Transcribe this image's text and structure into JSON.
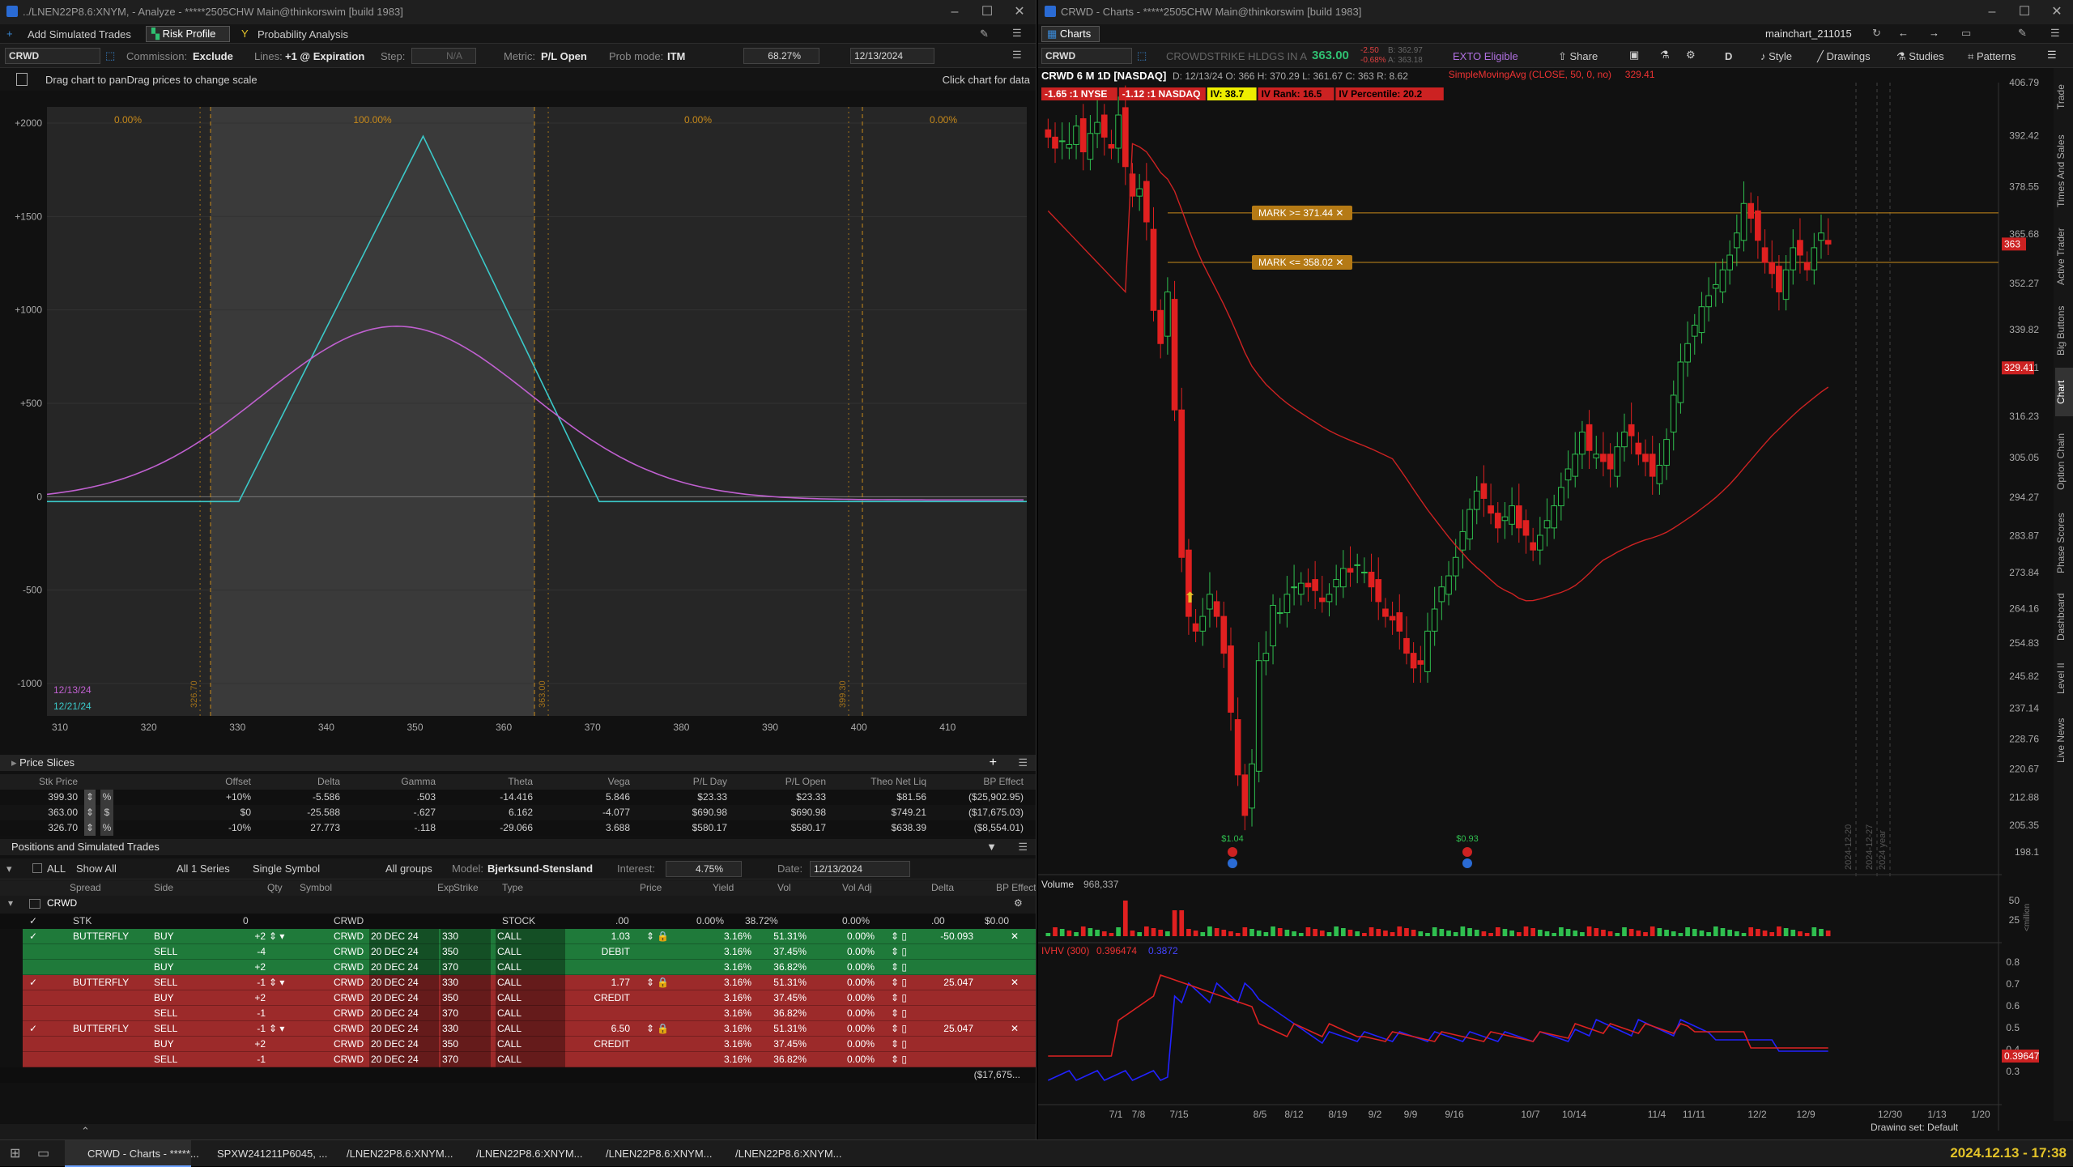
{
  "left": {
    "title": "../LNEN22P8.6:XNYM, - Analyze - *****2505CHW Main@thinkorswim [build 1983]",
    "toolbar": {
      "add_sim": "Add Simulated Trades",
      "risk_profile": "Risk Profile",
      "prob_analysis": "Probability Analysis"
    },
    "controls": {
      "symbol": "CRWD",
      "commission_lbl": "Commission:",
      "commission": "Exclude",
      "lines_lbl": "Lines:",
      "lines": "+1 @ Expiration",
      "step_lbl": "Step:",
      "step": "N/A",
      "metric_lbl": "Metric:",
      "metric": "P/L Open",
      "prob_lbl": "Prob mode:",
      "prob": "ITM",
      "pct": "68.27%",
      "date": "12/13/2024"
    },
    "hint": "Drag chart to panDrag prices to change scale",
    "click_hint": "Click chart for data",
    "chart": {
      "y_ticks": [
        "+2000",
        "+1500",
        "+1000",
        "+500",
        "0",
        "-500",
        "-1000"
      ],
      "y_vals": [
        2000,
        1500,
        1000,
        500,
        0,
        -500,
        -1000
      ],
      "x_ticks": [
        "310",
        "320",
        "330",
        "340",
        "350",
        "360",
        "370",
        "380",
        "390",
        "400",
        "410"
      ],
      "x_vals": [
        310,
        320,
        330,
        340,
        350,
        360,
        370,
        380,
        390,
        400,
        410
      ],
      "zone_labels": [
        "0.00%",
        "100.00%",
        "0.00%",
        "0.00%"
      ],
      "vlines": [
        "326.70",
        "363.00",
        "399.30"
      ],
      "legend": [
        "12/13/24",
        "12/21/24"
      ]
    },
    "price_slices": {
      "title": "Price Slices",
      "headers": [
        "Stk Price",
        "Offset",
        "Delta",
        "Gamma",
        "Theta",
        "Vega",
        "P/L Day",
        "P/L Open",
        "Theo Net Liq",
        "BP Effect"
      ],
      "rows": [
        {
          "stk": "399.30",
          "unit": "%",
          "offset": "+10%",
          "delta": "-5.586",
          "gamma": ".503",
          "theta": "-14.416",
          "vega": "5.846",
          "pld": "$23.33",
          "plo": "$23.33",
          "theo": "$81.56",
          "bp": "($25,902.95)"
        },
        {
          "stk": "363.00",
          "unit": "$",
          "offset": "$0",
          "delta": "-25.588",
          "gamma": "-.627",
          "theta": "6.162",
          "vega": "-4.077",
          "pld": "$690.98",
          "plo": "$690.98",
          "theo": "$749.21",
          "bp": "($17,675.03)"
        },
        {
          "stk": "326.70",
          "unit": "%",
          "offset": "-10%",
          "delta": "27.773",
          "gamma": "-.118",
          "theta": "-29.066",
          "vega": "3.688",
          "pld": "$580.17",
          "plo": "$580.17",
          "theo": "$638.39",
          "bp": "($8,554.01)"
        }
      ]
    },
    "positions": {
      "title": "Positions and Simulated Trades",
      "all": "ALL",
      "show": "Show All",
      "series": "All 1 Series",
      "single": "Single Symbol",
      "groups": "All groups",
      "model_lbl": "Model:",
      "model": "Bjerksund-Stensland",
      "interest_lbl": "Interest:",
      "interest": "4.75%",
      "date_lbl": "Date:",
      "date": "12/13/2024",
      "headers": [
        "Spread",
        "Side",
        "Qty",
        "Symbol",
        "Exp",
        "Strike",
        "Type",
        "Price",
        "Yield",
        "Vol",
        "Vol Adj",
        "Delta",
        "BP Effect"
      ],
      "group": "CRWD",
      "stk": {
        "spread": "STK",
        "qty": "0",
        "symbol": "CRWD",
        "type": "STOCK",
        "price": ".00",
        "yield": "0.00%",
        "vol": "38.72%",
        "voladj": "0.00%",
        "delta": ".00",
        "bp": "$0.00"
      },
      "rows": [
        {
          "cls": "grn",
          "spread": "BUTTERFLY",
          "side": "BUY",
          "qty": "+2",
          "symbol": "CRWD",
          "exp": "20 DEC 24",
          "strike": "330",
          "type": "CALL",
          "price": "1.03",
          "yield": "3.16%",
          "vol": "51.31%",
          "voladj": "0.00%",
          "delta": "-50.093"
        },
        {
          "cls": "grn",
          "spread": "",
          "side": "SELL",
          "qty": "-4",
          "symbol": "CRWD",
          "exp": "20 DEC 24",
          "strike": "350",
          "type": "CALL",
          "price": "DEBIT",
          "yield": "3.16%",
          "vol": "37.45%",
          "voladj": "0.00%",
          "delta": ""
        },
        {
          "cls": "grn",
          "spread": "",
          "side": "BUY",
          "qty": "+2",
          "symbol": "CRWD",
          "exp": "20 DEC 24",
          "strike": "370",
          "type": "CALL",
          "price": "",
          "yield": "3.16%",
          "vol": "36.82%",
          "voladj": "0.00%",
          "delta": ""
        },
        {
          "cls": "red",
          "spread": "BUTTERFLY",
          "side": "SELL",
          "qty": "-1",
          "symbol": "CRWD",
          "exp": "20 DEC 24",
          "strike": "330",
          "type": "CALL",
          "price": "1.77",
          "yield": "3.16%",
          "vol": "51.31%",
          "voladj": "0.00%",
          "delta": "25.047"
        },
        {
          "cls": "red",
          "spread": "",
          "side": "BUY",
          "qty": "+2",
          "symbol": "CRWD",
          "exp": "20 DEC 24",
          "strike": "350",
          "type": "CALL",
          "price": "CREDIT",
          "yield": "3.16%",
          "vol": "37.45%",
          "voladj": "0.00%",
          "delta": ""
        },
        {
          "cls": "red",
          "spread": "",
          "side": "SELL",
          "qty": "-1",
          "symbol": "CRWD",
          "exp": "20 DEC 24",
          "strike": "370",
          "type": "CALL",
          "price": "",
          "yield": "3.16%",
          "vol": "36.82%",
          "voladj": "0.00%",
          "delta": ""
        },
        {
          "cls": "red",
          "spread": "BUTTERFLY",
          "side": "SELL",
          "qty": "-1",
          "symbol": "CRWD",
          "exp": "20 DEC 24",
          "strike": "330",
          "type": "CALL",
          "price": "6.50",
          "yield": "3.16%",
          "vol": "51.31%",
          "voladj": "0.00%",
          "delta": "25.047"
        },
        {
          "cls": "red",
          "spread": "",
          "side": "BUY",
          "qty": "+2",
          "symbol": "CRWD",
          "exp": "20 DEC 24",
          "strike": "350",
          "type": "CALL",
          "price": "CREDIT",
          "yield": "3.16%",
          "vol": "37.45%",
          "voladj": "0.00%",
          "delta": ""
        },
        {
          "cls": "red",
          "spread": "",
          "side": "SELL",
          "qty": "-1",
          "symbol": "CRWD",
          "exp": "20 DEC 24",
          "strike": "370",
          "type": "CALL",
          "price": "",
          "yield": "3.16%",
          "vol": "36.82%",
          "voladj": "0.00%",
          "delta": ""
        }
      ],
      "total_bp": "($17,675..."
    }
  },
  "right": {
    "title": "CRWD - Charts - *****2505CHW Main@thinkorswim [build 1983]",
    "tab": "Charts",
    "layout": "mainchart_211015",
    "symbol": "CRWD",
    "company": "CROWDSTRIKE HLDGS IN A",
    "price": "363.00",
    "change": "-2.50",
    "change_pct": "-0.68%",
    "bid": "B: 362.97",
    "ask": "A: 363.18",
    "exto": "EXTO Eligible",
    "tools": [
      "Share",
      "D",
      "Style",
      "Drawings",
      "Studies",
      "Patterns"
    ],
    "header": "CRWD 6 M 1D [NASDAQ]",
    "ohlc": "D: 12/13/24 O: 366 H: 370.29 L: 361.67 C: 363 R: 8.62",
    "chips": [
      "-1.65 :1 NYSE",
      "-1.12 :1 NASDAQ",
      "IV: 38.7",
      "IV Rank: 16.5",
      "IV Percentile: 20.2"
    ],
    "sma": "SimpleMovingAvg (CLOSE, 50, 0, no)",
    "sma_val": "329.41",
    "alerts": [
      "MARK >= 371.44",
      "MARK <= 358.02"
    ],
    "price_axis": [
      "406.79",
      "392.42",
      "378.55",
      "365.68",
      "352.27",
      "339.82",
      "329.41",
      "316.23",
      "305.05",
      "294.27",
      "283.87",
      "273.84",
      "264.16",
      "254.83",
      "245.82",
      "237.14",
      "228.76",
      "220.67",
      "212.88",
      "205.35",
      "198.1"
    ],
    "price_tag": "363",
    "sma_tag": "329.41",
    "date_axis": [
      "7/1",
      "7/8",
      "7/15",
      "8/5",
      "8/12",
      "8/19",
      "9/2",
      "9/9",
      "9/16",
      "10/7",
      "10/14",
      "11/4",
      "11/11",
      "12/2",
      "12/9",
      "12/30",
      "1/13",
      "1/20"
    ],
    "future_marks": [
      "2024-12-20",
      "2024-12-27",
      "2024 year"
    ],
    "divs": [
      "$1.04",
      "$0.93"
    ],
    "volume": {
      "label": "Volume",
      "value": "968,337",
      "axis": [
        "50",
        "25"
      ],
      "unit": "<million"
    },
    "ivhv": {
      "label": "IVHV (300)",
      "iv": "0.396474",
      "hv": "0.3872",
      "axis": [
        "0.8",
        "0.7",
        "0.6",
        "0.5",
        "0.4",
        "0.3"
      ],
      "tag": "0.39647"
    },
    "drawing_set": "Drawing set: Default",
    "side_tabs": [
      "Trade",
      "Times And Sales",
      "Active Trader",
      "Big Buttons",
      "Chart",
      "Option Chain",
      "Phase Scores",
      "Dashboard",
      "Level II",
      "Live News"
    ],
    "chart_data": {
      "type": "candlestick",
      "closes": [
        392,
        389,
        391,
        390,
        395,
        388,
        393,
        396,
        392,
        389,
        398,
        384,
        376,
        378,
        369,
        345,
        336,
        350,
        318,
        278,
        262,
        258,
        262,
        268,
        262,
        252,
        236,
        219,
        208,
        222,
        250,
        252,
        265,
        263,
        268,
        270,
        271,
        270,
        269,
        266,
        268,
        272,
        275,
        274,
        276,
        274,
        270,
        266,
        262,
        261,
        258,
        252,
        248,
        249,
        258,
        264,
        270,
        273,
        278,
        285,
        291,
        296,
        294,
        290,
        286,
        289,
        292,
        286,
        284,
        280,
        284,
        288,
        292,
        297,
        302,
        306,
        312,
        307,
        306,
        304,
        302,
        308,
        312,
        311,
        306,
        304,
        300,
        303,
        310,
        322,
        331,
        336,
        341,
        346,
        349,
        352,
        356,
        360,
        366,
        374,
        370,
        364,
        358,
        355,
        350,
        356,
        362,
        360,
        356,
        362,
        366,
        363
      ]
    }
  },
  "taskbar": {
    "items": [
      "CRWD - Charts - *****...",
      "SPXW241211P6045, ...",
      "/LNEN22P8.6:XNYM...",
      "/LNEN22P8.6:XNYM...",
      "/LNEN22P8.6:XNYM...",
      "/LNEN22P8.6:XNYM..."
    ],
    "clock": "2024.12.13 - 17:38"
  }
}
